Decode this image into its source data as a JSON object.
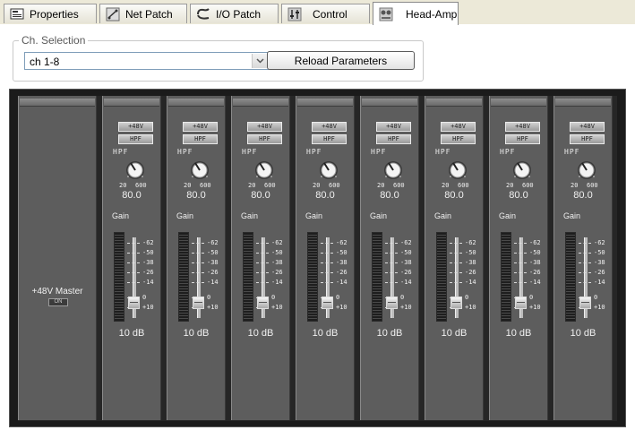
{
  "tabs": [
    {
      "label": "Properties",
      "icon": "properties-icon",
      "active": false
    },
    {
      "label": "Net Patch",
      "icon": "net-patch-icon",
      "active": false
    },
    {
      "label": "I/O Patch",
      "icon": "io-patch-icon",
      "active": false
    },
    {
      "label": "Control",
      "icon": "control-icon",
      "active": false
    },
    {
      "label": "Head-Amp",
      "icon": "head-amp-icon",
      "active": true
    }
  ],
  "ch_selection": {
    "legend": "Ch. Selection",
    "selected": "ch 1-8",
    "reload_label": "Reload Parameters"
  },
  "master": {
    "label": "+48V Master",
    "button_label": "ON"
  },
  "channels": [
    {
      "phantom_label": "+48V",
      "hpf_button": "HPF",
      "hpf_label": "HPF",
      "knob_min": "20",
      "knob_max": "600",
      "hpf_value": "80.0",
      "gain_label": "Gain",
      "gain_value": "10 dB",
      "fader_level_db": 10
    },
    {
      "phantom_label": "+48V",
      "hpf_button": "HPF",
      "hpf_label": "HPF",
      "knob_min": "20",
      "knob_max": "600",
      "hpf_value": "80.0",
      "gain_label": "Gain",
      "gain_value": "10 dB",
      "fader_level_db": 10
    },
    {
      "phantom_label": "+48V",
      "hpf_button": "HPF",
      "hpf_label": "HPF",
      "knob_min": "20",
      "knob_max": "600",
      "hpf_value": "80.0",
      "gain_label": "Gain",
      "gain_value": "10 dB",
      "fader_level_db": 10
    },
    {
      "phantom_label": "+48V",
      "hpf_button": "HPF",
      "hpf_label": "HPF",
      "knob_min": "20",
      "knob_max": "600",
      "hpf_value": "80.0",
      "gain_label": "Gain",
      "gain_value": "10 dB",
      "fader_level_db": 10
    },
    {
      "phantom_label": "+48V",
      "hpf_button": "HPF",
      "hpf_label": "HPF",
      "knob_min": "20",
      "knob_max": "600",
      "hpf_value": "80.0",
      "gain_label": "Gain",
      "gain_value": "10 dB",
      "fader_level_db": 10
    },
    {
      "phantom_label": "+48V",
      "hpf_button": "HPF",
      "hpf_label": "HPF",
      "knob_min": "20",
      "knob_max": "600",
      "hpf_value": "80.0",
      "gain_label": "Gain",
      "gain_value": "10 dB",
      "fader_level_db": 10
    },
    {
      "phantom_label": "+48V",
      "hpf_button": "HPF",
      "hpf_label": "HPF",
      "knob_min": "20",
      "knob_max": "600",
      "hpf_value": "80.0",
      "gain_label": "Gain",
      "gain_value": "10 dB",
      "fader_level_db": 10
    },
    {
      "phantom_label": "+48V",
      "hpf_button": "HPF",
      "hpf_label": "HPF",
      "knob_min": "20",
      "knob_max": "600",
      "hpf_value": "80.0",
      "gain_label": "Gain",
      "gain_value": "10 dB",
      "fader_level_db": 10
    }
  ],
  "fader_scale": [
    "-62",
    "-50",
    "-38",
    "-26",
    "-14",
    "0",
    "+10"
  ],
  "colors": {
    "mixer_bg": "#262626",
    "strip_bg": "#5d5d5d",
    "tab_bg": "#ece9d8"
  }
}
